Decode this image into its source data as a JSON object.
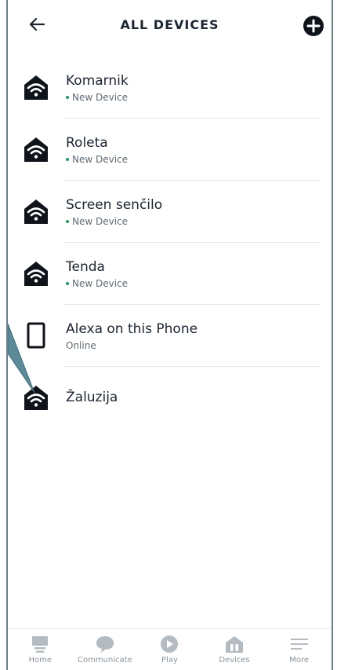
{
  "header": {
    "title": "ALL DEVICES",
    "back_icon": "arrow-left-icon",
    "add_icon": "plus-circle-icon"
  },
  "devices": [
    {
      "name": "Komarnik",
      "status": "New Device",
      "icon": "smart-home-wifi-icon",
      "status_dot": true
    },
    {
      "name": "Roleta",
      "status": "New Device",
      "icon": "smart-home-wifi-icon",
      "status_dot": true
    },
    {
      "name": "Screen senčilo",
      "status": "New Device",
      "icon": "smart-home-wifi-icon",
      "status_dot": true
    },
    {
      "name": "Tenda",
      "status": "New Device",
      "icon": "smart-home-wifi-icon",
      "status_dot": true
    },
    {
      "name": "Alexa on this Phone",
      "status": "Online",
      "icon": "phone-icon",
      "status_dot": false
    },
    {
      "name": "Žaluzija",
      "status": "",
      "icon": "smart-home-wifi-icon",
      "status_dot": false
    }
  ],
  "tabs": [
    {
      "label": "Home",
      "icon": "home-icon"
    },
    {
      "label": "Communicate",
      "icon": "chat-bubble-icon"
    },
    {
      "label": "Play",
      "icon": "play-icon"
    },
    {
      "label": "Devices",
      "icon": "devices-icon"
    },
    {
      "label": "More",
      "icon": "menu-icon"
    }
  ],
  "colors": {
    "status_green": "#1a9c5b",
    "icon_dark": "#0f141a",
    "tab_inactive": "#b4bcc2",
    "callout_fill": "#5b8a99"
  }
}
